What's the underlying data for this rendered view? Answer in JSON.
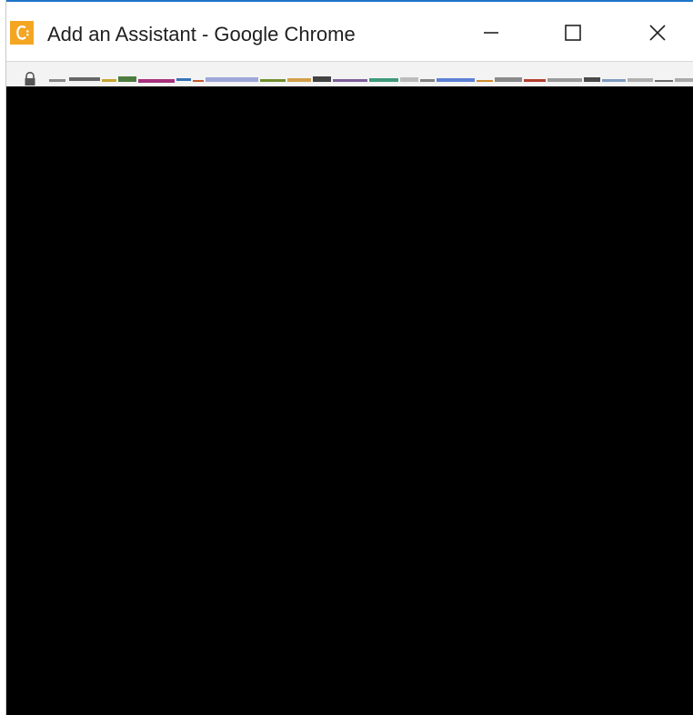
{
  "window": {
    "title": "Add an Assistant - Google Chrome"
  },
  "icons": {
    "app": "chrome-window-app-icon",
    "minimize": "minimize-icon",
    "maximize": "maximize-icon",
    "close": "close-icon",
    "lock": "lock-icon"
  },
  "colors": {
    "app_icon_bg": "#f4a623",
    "title_bar_accent": "#1f73c9",
    "toolbar_bg": "#f3f3f3",
    "content_bg": "#000000"
  }
}
